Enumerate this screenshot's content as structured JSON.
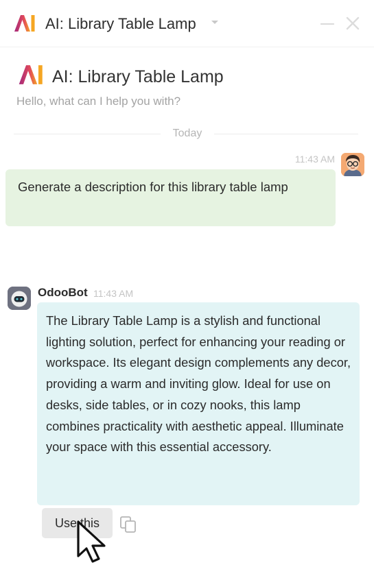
{
  "window": {
    "title": "AI: Library Table Lamp"
  },
  "chat": {
    "title": "AI: Library Table Lamp",
    "subtitle": "Hello, what can I help you with?",
    "date_separator": "Today"
  },
  "messages": [
    {
      "author": "",
      "time": "11:43 AM",
      "text": "Generate a description for this library table lamp"
    },
    {
      "author": "OdooBot",
      "time": "11:43 AM",
      "text": "The Library Table Lamp is a stylish and functional lighting solution, perfect for enhancing your reading or workspace. Its elegant design complements any decor, providing a warm and inviting glow. Ideal for use on desks, side tables, or in cozy nooks, this lamp combines practicality with aesthetic appeal. Illuminate your space with this essential accessory."
    }
  ],
  "actions": {
    "use_label": "Use this"
  },
  "colors": {
    "user_bubble": "#e6f3e1",
    "bot_bubble": "#e2f4f5",
    "logo_gradient_start": "#a3287c",
    "logo_gradient_end": "#f5a623"
  },
  "icons": {
    "logo": "ai-logo-icon",
    "caret": "caret-down-icon",
    "minimize": "minimize-icon",
    "close": "close-icon",
    "copy": "copy-icon",
    "pointer": "mouse-pointer-icon"
  }
}
